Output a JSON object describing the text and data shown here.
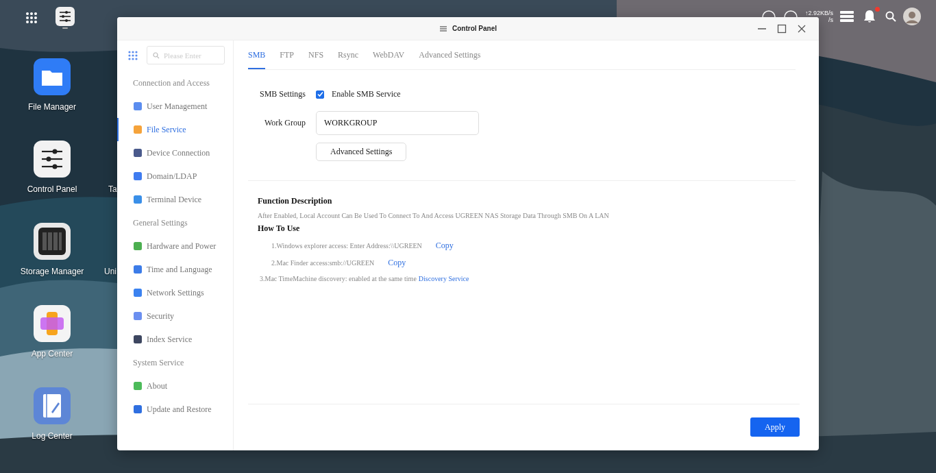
{
  "desktop": {
    "apps": [
      {
        "label": "File Manager",
        "kind": "folder"
      },
      {
        "label": "Control Panel",
        "kind": "sliders"
      },
      {
        "label": "Storage Manager",
        "kind": "drives"
      },
      {
        "label": "App Center",
        "kind": "apps"
      },
      {
        "label": "Log Center",
        "kind": "log"
      }
    ],
    "partial_labels": [
      "Ta",
      "Uni"
    ]
  },
  "top_bar": {
    "speed_up": "↑2.92KB/s",
    "speed_down": "/s",
    "notification_dot": true
  },
  "window": {
    "title": "Control Panel",
    "search": {
      "placeholder": "Please Enter"
    },
    "sidebar": [
      {
        "kind": "section",
        "label": "Connection and Access"
      },
      {
        "kind": "item",
        "label": "User Management",
        "selected": false,
        "color": "#5b8def"
      },
      {
        "kind": "item",
        "label": "File Service",
        "selected": true,
        "color": "#f5a33b"
      },
      {
        "kind": "item",
        "label": "Device Connection",
        "selected": false,
        "color": "#4a5a8c"
      },
      {
        "kind": "item",
        "label": "Domain/LDAP",
        "selected": false,
        "color": "#3f7cf0"
      },
      {
        "kind": "item",
        "label": "Terminal Device",
        "selected": false,
        "color": "#3a8fe8"
      },
      {
        "kind": "section",
        "label": "General Settings"
      },
      {
        "kind": "item",
        "label": "Hardware and Power",
        "selected": false,
        "color": "#4caf50"
      },
      {
        "kind": "item",
        "label": "Time and Language",
        "selected": false,
        "color": "#3c7ce8"
      },
      {
        "kind": "item",
        "label": "Network Settings",
        "selected": false,
        "color": "#3b82f0"
      },
      {
        "kind": "item",
        "label": "Security",
        "selected": false,
        "color": "#6b8ff0"
      },
      {
        "kind": "item",
        "label": "Index Service",
        "selected": false,
        "color": "#3d4660"
      },
      {
        "kind": "section",
        "label": "System Service"
      },
      {
        "kind": "item",
        "label": "About",
        "selected": false,
        "color": "#4cbb5a"
      },
      {
        "kind": "item",
        "label": "Update and Restore",
        "selected": false,
        "color": "#2f6fe0"
      }
    ],
    "tabs": [
      {
        "label": "SMB",
        "selected": true
      },
      {
        "label": "FTP",
        "selected": false
      },
      {
        "label": "NFS",
        "selected": false
      },
      {
        "label": "Rsync",
        "selected": false
      },
      {
        "label": "WebDAV",
        "selected": false
      },
      {
        "label": "Advanced Settings",
        "selected": false
      }
    ],
    "smb_settings": {
      "label": "SMB Settings",
      "checkbox_label": "Enable SMB Service",
      "checked": true
    },
    "work_group": {
      "label": "Work Group",
      "value": "WORKGROUP"
    },
    "advanced_button": "Advanced Settings",
    "function_description": {
      "heading": "Function Description",
      "text": "After Enabled, Local Account Can Be Used To Connect To And Access UGREEN NAS Storage Data Through SMB On A LAN"
    },
    "how_to_use": {
      "heading": "How To Use",
      "steps": [
        {
          "text": "1.Windows explorer access: Enter Address:\\\\UGREEN",
          "kind": "copy",
          "action": "Copy"
        },
        {
          "text": "2.Mac Finder access:smb://UGREEN",
          "kind": "copy",
          "action": "Copy"
        },
        {
          "text": "3.Mac TimeMachine discovery: enabled at the same time",
          "kind": "link",
          "action": "Discovery Service"
        }
      ]
    },
    "apply_button": "Apply"
  }
}
